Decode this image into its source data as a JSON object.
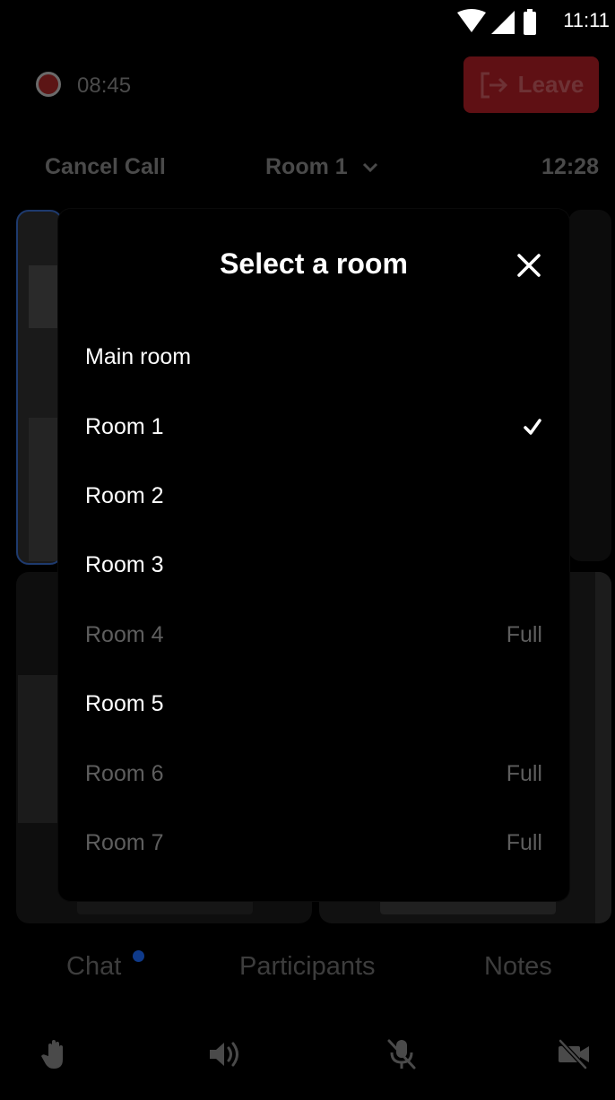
{
  "status_bar": {
    "time": "11:11"
  },
  "call_bar": {
    "recording_time": "08:45",
    "leave_label": "Leave",
    "cancel_call_label": "Cancel Call",
    "current_room": "Room 1",
    "call_timer": "12:28"
  },
  "modal": {
    "title": "Select a room",
    "rooms": [
      {
        "label": "Main room",
        "status": ""
      },
      {
        "label": "Room 1",
        "status": ""
      },
      {
        "label": "Room 2",
        "status": ""
      },
      {
        "label": "Room 3",
        "status": ""
      },
      {
        "label": "Room 4",
        "status": "Full"
      },
      {
        "label": "Room 5",
        "status": ""
      },
      {
        "label": "Room 6",
        "status": "Full"
      },
      {
        "label": "Room 7",
        "status": "Full"
      }
    ]
  },
  "tabs": {
    "chat": "Chat",
    "participants": "Participants",
    "notes": "Notes"
  },
  "colors": {
    "recording": "#5c1515",
    "leave": "#5f1014",
    "unread_dot": "#0f3a8a",
    "full_text": "#5e5e5e"
  },
  "icons": [
    "wifi-icon",
    "signal-icon",
    "battery-icon",
    "leave-icon",
    "chevron-down-icon",
    "close-icon",
    "checkmark-icon",
    "hand-icon",
    "speaker-icon",
    "mic-off-icon",
    "video-off-icon"
  ]
}
